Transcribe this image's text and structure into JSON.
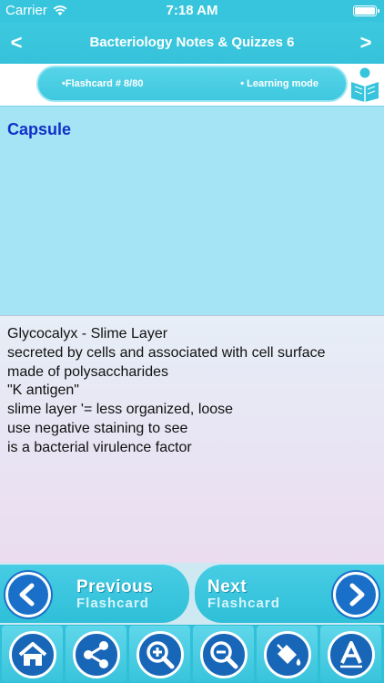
{
  "status_bar": {
    "carrier": "Carrier",
    "time": "7:18 AM"
  },
  "nav": {
    "title": "Bacteriology Notes & Quizzes 6",
    "back": "<",
    "forward": ">"
  },
  "info": {
    "flashcard_label": "•Flashcard #  8/80",
    "mode_label": "• Learning mode"
  },
  "question": {
    "title": "Capsule"
  },
  "answer": {
    "lines": [
      "Glycocalyx - Slime Layer",
      "secreted by cells and associated with cell surface",
      "made of polysaccharides",
      "\"K antigen\"",
      "slime layer '= less organized, loose",
      "use negative staining to see",
      "is a bacterial virulence factor"
    ]
  },
  "buttons": {
    "prev_big": "Previous",
    "prev_small": "Flashcard",
    "next_big": "Next",
    "next_small": "Flashcard"
  },
  "toolbar": {
    "icons": [
      "home-icon",
      "share-icon",
      "zoom-in-icon",
      "zoom-out-icon",
      "paint-bucket-icon",
      "font-icon"
    ]
  },
  "colors": {
    "accent": "#36c5dd",
    "question_bg": "#a4e4f4",
    "title_blue": "#1030c8",
    "circle_blue": "#1a70c8"
  }
}
